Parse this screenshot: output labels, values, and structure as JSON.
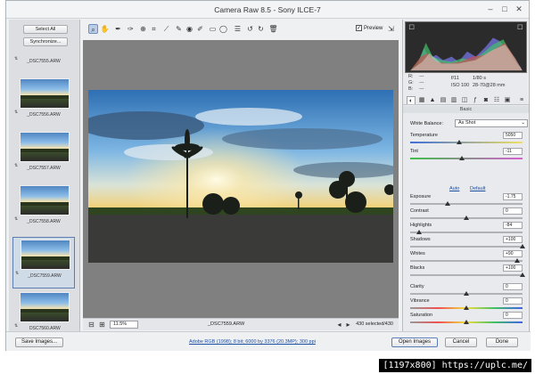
{
  "window": {
    "title": "Camera Raw 8.5  -  Sony ILCE-7"
  },
  "filmstrip": {
    "select_all": "Select All",
    "synchronize": "Synchronize...",
    "thumbnails": [
      {
        "name": "_DSC7555.ARW",
        "selected": false
      },
      {
        "name": "_DSC7556.ARW",
        "selected": false
      },
      {
        "name": "_DSC7557.ARW",
        "selected": false
      },
      {
        "name": "_DSC7558.ARW",
        "selected": false
      },
      {
        "name": "_DSC7559.ARW",
        "selected": true
      },
      {
        "name": "_DSC7560.ARW",
        "selected": false
      }
    ]
  },
  "toolbar": {
    "tools": [
      "zoom-icon",
      "hand-icon",
      "white-balance-icon",
      "color-sampler-icon",
      "target-adjust-icon",
      "crop-icon",
      "straighten-icon",
      "spot-removal-icon",
      "red-eye-icon",
      "adjustment-brush-icon",
      "graduated-filter-icon",
      "radial-filter-icon",
      "preferences-icon",
      "rotate-ccw-icon",
      "rotate-cw-icon",
      "trash-icon"
    ],
    "preview_label": "Preview",
    "preview_checked": true
  },
  "canvas": {
    "zoom": "11.5%",
    "filename": "_DSC7559.ARW",
    "selection": "430 selected/430"
  },
  "readout": {
    "r": "R:",
    "g": "G:",
    "b": "B:",
    "dash": "---",
    "aperture": "f/11",
    "shutter": "1/80 s",
    "iso": "ISO 100",
    "lens": "28-70@28 mm"
  },
  "panel": {
    "section": "Basic",
    "white_balance_label": "White Balance:",
    "white_balance_value": "As Shot",
    "auto": "Auto",
    "default": "Default",
    "sliders": [
      {
        "label": "Temperature",
        "value": "5050",
        "pos": 0.44
      },
      {
        "label": "Tint",
        "value": "-11",
        "pos": 0.46
      },
      {
        "label": "Exposure",
        "value": "-1.75",
        "pos": 0.33
      },
      {
        "label": "Contrast",
        "value": "0",
        "pos": 0.5
      },
      {
        "label": "Highlights",
        "value": "-84",
        "pos": 0.08
      },
      {
        "label": "Shadows",
        "value": "+100",
        "pos": 1.0
      },
      {
        "label": "Whites",
        "value": "+90",
        "pos": 0.95
      },
      {
        "label": "Blacks",
        "value": "+100",
        "pos": 1.0
      },
      {
        "label": "Clarity",
        "value": "0",
        "pos": 0.5
      },
      {
        "label": "Vibrance",
        "value": "0",
        "pos": 0.5
      },
      {
        "label": "Saturation",
        "value": "0",
        "pos": 0.5
      }
    ]
  },
  "footer": {
    "save": "Save Images...",
    "workflow": "Adobe RGB (1998); 8 bit; 6000 by 3376 (20.3MP); 300 ppi",
    "open": "Open Images",
    "cancel": "Cancel",
    "done": "Done"
  },
  "watermark": "[1197x800] https://uplc.me/"
}
